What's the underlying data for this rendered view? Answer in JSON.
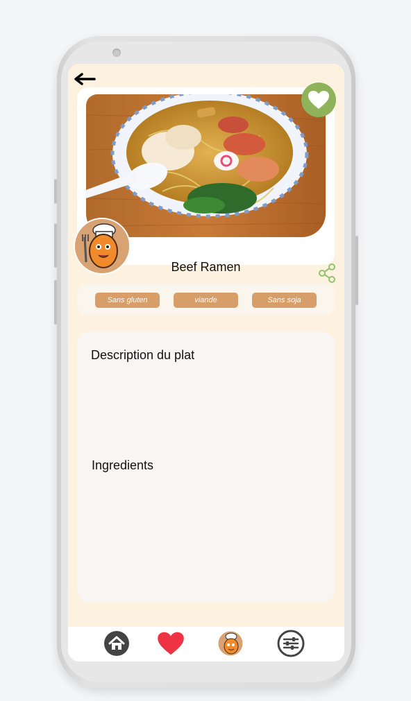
{
  "dish": {
    "title": "Beef Ramen"
  },
  "tags": [
    "Sans gluten",
    "viande",
    "Sans soja"
  ],
  "sections": {
    "description_title": "Description du plat",
    "ingredients_title": "Ingredients"
  },
  "icons": {
    "back": "arrow-left-icon",
    "favorite": "heart-icon",
    "share": "share-icon",
    "home": "home-icon",
    "favorites_nav": "heart-icon",
    "profile": "chef-avatar",
    "settings": "sliders-icon"
  },
  "colors": {
    "screen_bg": "#fdf2df",
    "favorite_accent": "#8fb35a",
    "tag_bg": "#d89e69",
    "heart_red": "#ee3344",
    "share_green": "#8fc46a"
  }
}
